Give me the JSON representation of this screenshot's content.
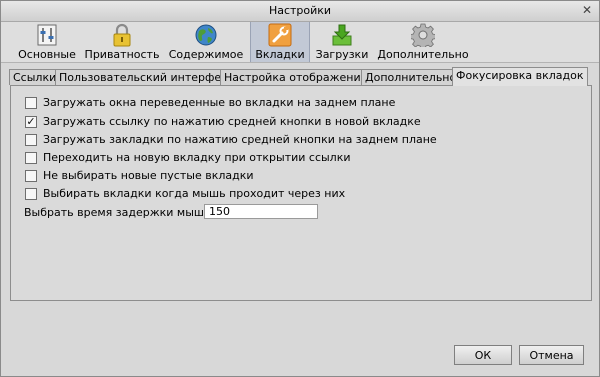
{
  "window": {
    "title": "Настройки"
  },
  "toolbar": {
    "items": [
      {
        "label": "Основные",
        "icon": "general-settings-icon"
      },
      {
        "label": "Приватность",
        "icon": "padlock-icon"
      },
      {
        "label": "Содержимое",
        "icon": "globe-icon"
      },
      {
        "label": "Вкладки",
        "icon": "wrench-icon",
        "active": true
      },
      {
        "label": "Загрузки",
        "icon": "download-icon"
      },
      {
        "label": "Дополнительно",
        "icon": "gear-icon"
      }
    ]
  },
  "tabs": [
    {
      "label": "Ссылки"
    },
    {
      "label": "Пользовательский интерфейс"
    },
    {
      "label": "Настройка отображения"
    },
    {
      "label": "Дополнительно"
    },
    {
      "label": "Фокусировка вкладок",
      "active": true
    }
  ],
  "options": [
    {
      "label": "Загружать окна переведенные во вкладки на заднем плане",
      "checked": false
    },
    {
      "label": "Загружать ссылку по нажатию средней кнопки в новой вкладке",
      "checked": true
    },
    {
      "label": "Загружать закладки по нажатию средней кнопки на заднем плане",
      "checked": false
    },
    {
      "label": "Переходить на новую вкладку при открытии ссылки",
      "checked": false
    },
    {
      "label": "Не выбирать новые пустые вкладки",
      "checked": false
    },
    {
      "label": "Выбирать вкладки когда мышь проходит через них",
      "checked": false
    }
  ],
  "delay": {
    "label": "Выбрать время задержки мыши:",
    "value": "150"
  },
  "buttons": {
    "ok": "ОК",
    "cancel": "Отмена"
  },
  "colors": {
    "active_toolbar_bg": "#c2c9d6",
    "window_bg": "#d8d8d8"
  }
}
